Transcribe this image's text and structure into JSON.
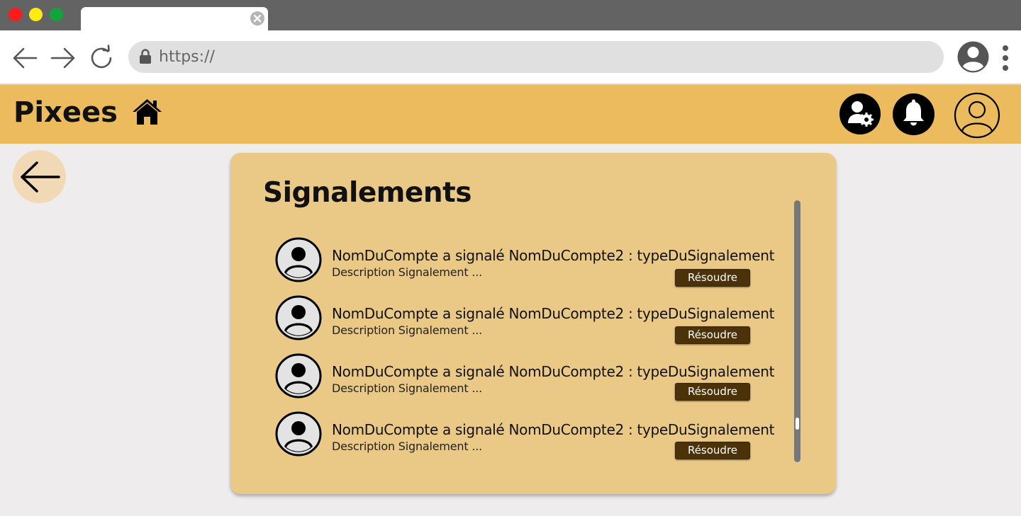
{
  "browser": {
    "url": "https://"
  },
  "app": {
    "brand": "Pixees"
  },
  "card": {
    "title": "Signalements",
    "reports": [
      {
        "text": "NomDuCompte a signalé NomDuCompte2 : typeDuSignalement",
        "description": "Description Signalement ...",
        "action": "Résoudre"
      },
      {
        "text": "NomDuCompte a signalé NomDuCompte2 : typeDuSignalement",
        "description": "Description Signalement ...",
        "action": "Résoudre"
      },
      {
        "text": "NomDuCompte a signalé NomDuCompte2 : typeDuSignalement",
        "description": "Description Signalement ...",
        "action": "Résoudre"
      },
      {
        "text": "NomDuCompte a signalé NomDuCompte2 : typeDuSignalement",
        "description": "Description Signalement ...",
        "action": "Résoudre"
      }
    ]
  },
  "colors": {
    "header": "#ebbb5e",
    "card": "#eac987",
    "button": "#4c3209",
    "page": "#eeecec"
  },
  "icons": [
    "tab-close-icon",
    "back-arrow-icon",
    "forward-arrow-icon",
    "reload-icon",
    "lock-icon",
    "browser-profile-icon",
    "kebab-menu-icon",
    "home-icon",
    "admin-settings-icon",
    "bell-icon",
    "account-icon",
    "back-icon",
    "user-avatar-icon"
  ]
}
